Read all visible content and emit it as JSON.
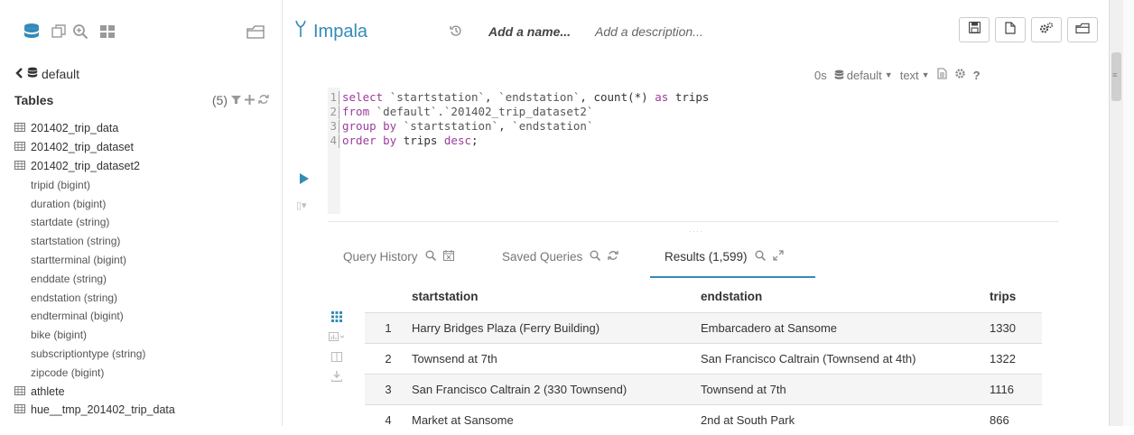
{
  "editor": {
    "app_name": "Impala",
    "name_placeholder": "Add a name...",
    "description_placeholder": "Add a description..."
  },
  "assist": {
    "database": "default",
    "tables_label": "Tables",
    "tables_count": "(5)",
    "tables": [
      {
        "name": "201402_trip_data"
      },
      {
        "name": "201402_trip_dataset"
      },
      {
        "name": "201402_trip_dataset2"
      },
      {
        "name": "athlete"
      },
      {
        "name": "hue__tmp_201402_trip_data"
      }
    ],
    "columns": [
      "tripid (bigint)",
      "duration (bigint)",
      "startdate (string)",
      "startstation (string)",
      "startterminal (bigint)",
      "enddate (string)",
      "endstation (string)",
      "endterminal (bigint)",
      "bike (bigint)",
      "subscriptiontype (string)",
      "zipcode (bigint)"
    ]
  },
  "snippet": {
    "exec_time": "0s",
    "database": "default",
    "format": "text",
    "code_lines": [
      {
        "num": "1",
        "text": "select `startstation`, `endstation`, count(*) as trips"
      },
      {
        "num": "2",
        "text": "from `default`.`201402_trip_dataset2`"
      },
      {
        "num": "3",
        "text": "group by `startstation`, `endstation`"
      },
      {
        "num": "4",
        "text": "order by trips desc;"
      }
    ]
  },
  "tabs": {
    "history": "Query History",
    "saved": "Saved Queries",
    "results": "Results (1,599)"
  },
  "results": {
    "headers": [
      "startstation",
      "endstation",
      "trips"
    ],
    "rows": [
      {
        "idx": "1",
        "startstation": "Harry Bridges Plaza (Ferry Building)",
        "endstation": "Embarcadero at Sansome",
        "trips": "1330"
      },
      {
        "idx": "2",
        "startstation": "Townsend at 7th",
        "endstation": "San Francisco Caltrain (Townsend at 4th)",
        "trips": "1322"
      },
      {
        "idx": "3",
        "startstation": "San Francisco Caltrain 2 (330 Townsend)",
        "endstation": "Townsend at 7th",
        "trips": "1116"
      },
      {
        "idx": "4",
        "startstation": "Market at Sansome",
        "endstation": "2nd at South Park",
        "trips": "866"
      }
    ]
  },
  "colors": {
    "accent": "#338bb8",
    "keyword": "#9b3c9b",
    "row_alt": "#f5f5f5"
  },
  "icons": [
    "database-icon",
    "tables-icon",
    "search-plus-icon",
    "grid-icon",
    "folder-open-icon",
    "chevron-left-icon",
    "filter-icon",
    "plus-icon",
    "refresh-icon",
    "history-icon",
    "save-icon",
    "new-doc-icon",
    "settings-icon",
    "play-icon",
    "expand-icon"
  ]
}
